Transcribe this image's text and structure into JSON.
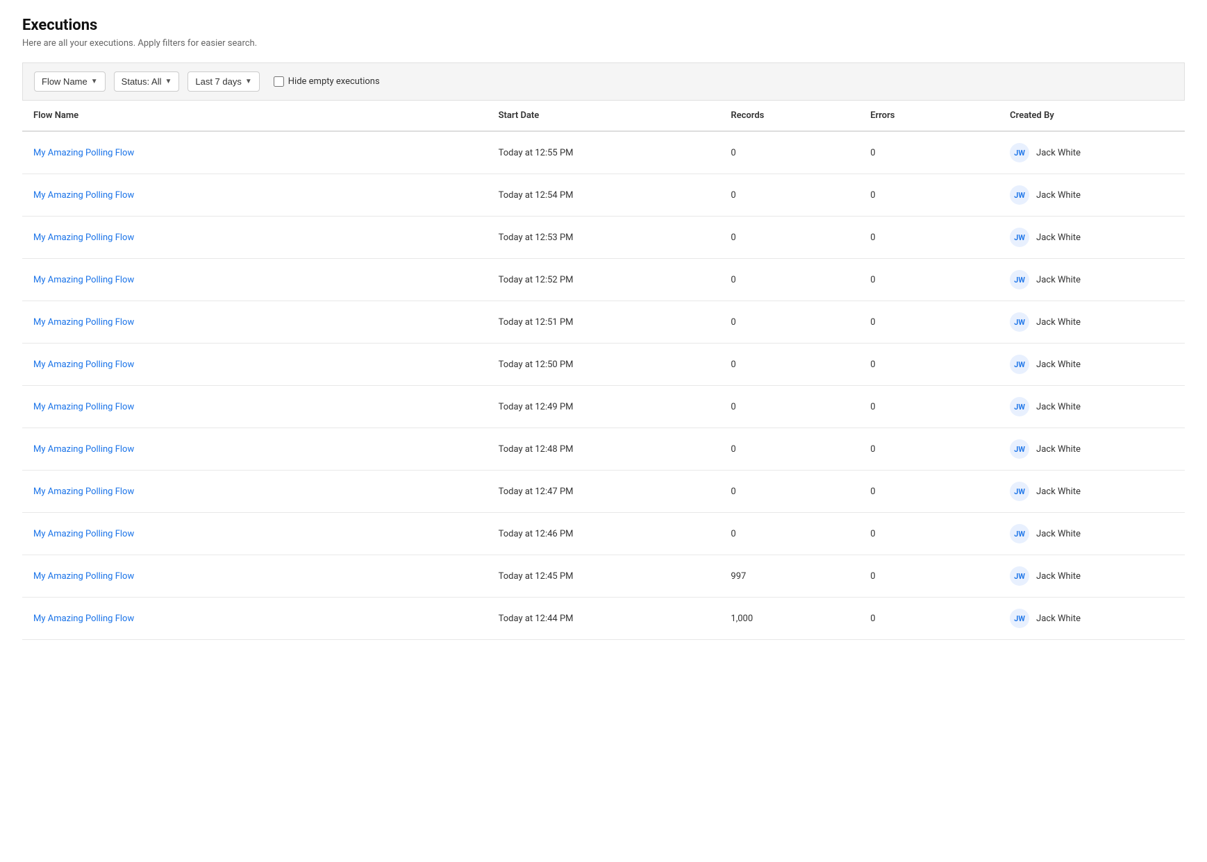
{
  "page": {
    "title": "Executions",
    "subtitle": "Here are all your executions. Apply filters for easier search."
  },
  "filters": {
    "flow_name_label": "Flow Name",
    "status_label": "Status: All",
    "date_range_label": "Last 7 days",
    "hide_empty_label": "Hide empty executions"
  },
  "table": {
    "columns": [
      "Flow Name",
      "Start Date",
      "Records",
      "Errors",
      "Created By"
    ],
    "rows": [
      {
        "flow_name": "My Amazing Polling Flow",
        "start_date": "Today at 12:55 PM",
        "records": "0",
        "errors": "0",
        "avatar": "JW",
        "created_by": "Jack White"
      },
      {
        "flow_name": "My Amazing Polling Flow",
        "start_date": "Today at 12:54 PM",
        "records": "0",
        "errors": "0",
        "avatar": "JW",
        "created_by": "Jack White"
      },
      {
        "flow_name": "My Amazing Polling Flow",
        "start_date": "Today at 12:53 PM",
        "records": "0",
        "errors": "0",
        "avatar": "JW",
        "created_by": "Jack White"
      },
      {
        "flow_name": "My Amazing Polling Flow",
        "start_date": "Today at 12:52 PM",
        "records": "0",
        "errors": "0",
        "avatar": "JW",
        "created_by": "Jack White"
      },
      {
        "flow_name": "My Amazing Polling Flow",
        "start_date": "Today at 12:51 PM",
        "records": "0",
        "errors": "0",
        "avatar": "JW",
        "created_by": "Jack White"
      },
      {
        "flow_name": "My Amazing Polling Flow",
        "start_date": "Today at 12:50 PM",
        "records": "0",
        "errors": "0",
        "avatar": "JW",
        "created_by": "Jack White"
      },
      {
        "flow_name": "My Amazing Polling Flow",
        "start_date": "Today at 12:49 PM",
        "records": "0",
        "errors": "0",
        "avatar": "JW",
        "created_by": "Jack White"
      },
      {
        "flow_name": "My Amazing Polling Flow",
        "start_date": "Today at 12:48 PM",
        "records": "0",
        "errors": "0",
        "avatar": "JW",
        "created_by": "Jack White"
      },
      {
        "flow_name": "My Amazing Polling Flow",
        "start_date": "Today at 12:47 PM",
        "records": "0",
        "errors": "0",
        "avatar": "JW",
        "created_by": "Jack White"
      },
      {
        "flow_name": "My Amazing Polling Flow",
        "start_date": "Today at 12:46 PM",
        "records": "0",
        "errors": "0",
        "avatar": "JW",
        "created_by": "Jack White"
      },
      {
        "flow_name": "My Amazing Polling Flow",
        "start_date": "Today at 12:45 PM",
        "records": "997",
        "errors": "0",
        "avatar": "JW",
        "created_by": "Jack White"
      },
      {
        "flow_name": "My Amazing Polling Flow",
        "start_date": "Today at 12:44 PM",
        "records": "1,000",
        "errors": "0",
        "avatar": "JW",
        "created_by": "Jack White"
      }
    ]
  }
}
